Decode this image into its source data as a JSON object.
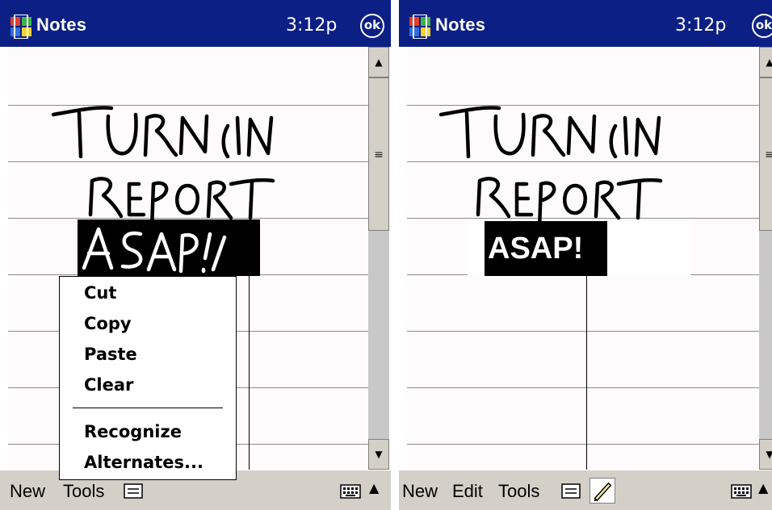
{
  "left": {
    "app_title": "Notes",
    "clock": "3:12p",
    "ok_label": "ok",
    "ink_lines": [
      "TURN IN",
      "REPORT",
      "A SAP!"
    ],
    "context_menu": [
      "Cut",
      "Copy",
      "Paste",
      "Clear",
      "Recognize",
      "Alternates..."
    ],
    "menubar": [
      "New",
      "Tools"
    ]
  },
  "right": {
    "app_title": "Notes",
    "clock": "3:12p",
    "ok_label": "ok",
    "ink_lines": [
      "TURN IN",
      "REPORT"
    ],
    "recognized_text": "ASAP!",
    "menubar": [
      "New",
      "Edit",
      "Tools"
    ]
  },
  "icons": [
    "start-flag-icon",
    "ok-button-icon",
    "scroll-up-icon",
    "scroll-down-icon",
    "keyboard-icon",
    "input-panel-arrow-icon",
    "pen-icon",
    "recognizer-icon"
  ],
  "colors": {
    "titlebar": "#0c1f84",
    "paper": "#fdfbfb",
    "selection": "#000000",
    "menubar": "#d4d0c8"
  }
}
